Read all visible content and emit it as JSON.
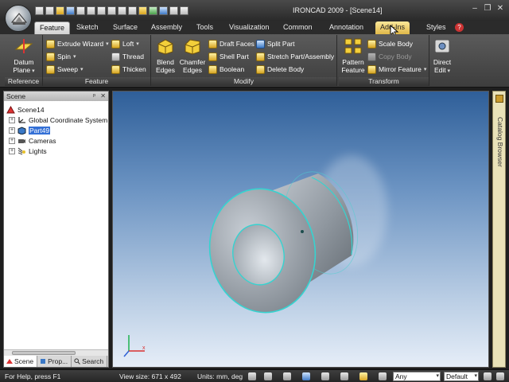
{
  "title_bar": {
    "title": "IRONCAD 2009 - [Scene14]",
    "minimize": "–",
    "restore": "❐",
    "close": "✕"
  },
  "tabs": [
    {
      "label": "Feature",
      "state": "active"
    },
    {
      "label": "Sketch",
      "state": "normal"
    },
    {
      "label": "Surface",
      "state": "normal"
    },
    {
      "label": "Assembly",
      "state": "normal"
    },
    {
      "label": "Tools",
      "state": "normal"
    },
    {
      "label": "Visualization",
      "state": "normal"
    },
    {
      "label": "Common",
      "state": "normal"
    },
    {
      "label": "Annotation",
      "state": "normal"
    },
    {
      "label": "Add-Ins",
      "state": "hover"
    }
  ],
  "styles_label": "Styles",
  "ribbon": {
    "reference": {
      "label": "Reference",
      "datum_line1": "Datum",
      "datum_line2": "Plane"
    },
    "feature": {
      "label": "Feature",
      "extrude_wizard": "Extrude Wizard",
      "spin": "Spin",
      "sweep": "Sweep",
      "loft": "Loft",
      "thread": "Thread",
      "thicken": "Thicken"
    },
    "modify": {
      "label": "Modify",
      "blend_line1": "Blend",
      "blend_line2": "Edges",
      "chamfer_line1": "Chamfer",
      "chamfer_line2": "Edges",
      "draft_faces": "Draft Faces",
      "shell_part": "Shell Part",
      "boolean": "Boolean",
      "split_part": "Split Part",
      "stretch_part": "Stretch Part/Assembly",
      "delete_body": "Delete Body"
    },
    "transform": {
      "label": "Transform",
      "pattern_line1": "Pattern",
      "pattern_line2": "Feature",
      "scale_body": "Scale Body",
      "copy_body": "Copy Body",
      "mirror_feature": "Mirror Feature",
      "direct_line1": "Direct",
      "direct_line2": "Edit"
    }
  },
  "scene_panel": {
    "title": "Scene",
    "pin": "ᵖ",
    "close": "✕",
    "tree": [
      {
        "label": "Scene14",
        "expander": "",
        "selected": false
      },
      {
        "label": "Global Coordinate System",
        "expander": "+",
        "selected": false
      },
      {
        "label": "Part49",
        "expander": "+",
        "selected": true
      },
      {
        "label": "Cameras",
        "expander": "+",
        "selected": false
      },
      {
        "label": "Lights",
        "expander": "+",
        "selected": false
      }
    ],
    "bottom_tabs": [
      "Scene",
      "Prop...",
      "Search"
    ]
  },
  "catalog_browser": {
    "label": "Catalog Browser"
  },
  "status_bar": {
    "help": "For Help, press F1",
    "view_size": "View size: 671 x 492",
    "units": "Units: mm, deg",
    "filter_combo": "Any",
    "style_combo": "Default"
  }
}
